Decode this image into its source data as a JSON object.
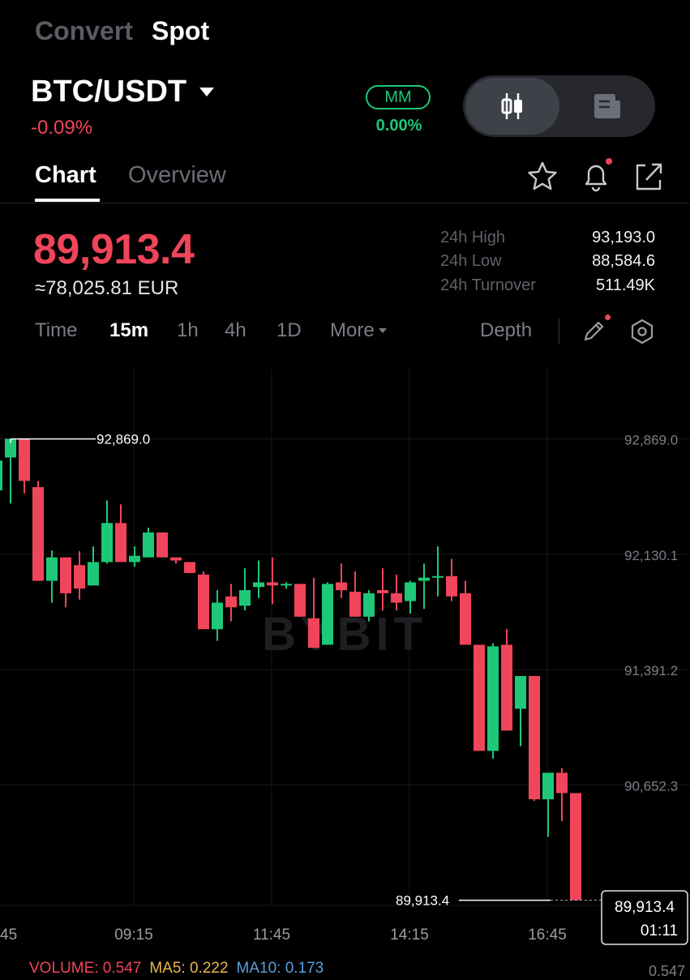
{
  "header": {
    "convert_label": "Convert",
    "spot_label": "Spot"
  },
  "pair": {
    "symbol": "BTC/USDT",
    "change": "-0.09%",
    "mm_badge": "MM",
    "mm_value": "0.00%"
  },
  "tabs": {
    "chart": "Chart",
    "overview": "Overview"
  },
  "price": {
    "last": "89,913.4",
    "eur": "≈78,025.81 EUR",
    "stats": [
      {
        "label": "24h High",
        "value": "93,193.0"
      },
      {
        "label": "24h Low",
        "value": "88,584.6"
      },
      {
        "label": "24h Turnover",
        "value": "511.49K"
      }
    ]
  },
  "timeframes": {
    "time": "Time",
    "m15": "15m",
    "h1": "1h",
    "h4": "4h",
    "d1": "1D",
    "more": "More",
    "depth": "Depth",
    "active": "15m"
  },
  "colors": {
    "up": "#1ec878",
    "down": "#f0455a",
    "background": "#000000"
  },
  "watermark": "BYBIT",
  "chart_data": {
    "type": "candlestick",
    "interval": "15m",
    "y_ticks": [
      "92,869.0",
      "92,130.1",
      "91,391.2",
      "90,652.3"
    ],
    "y_tick_values": [
      92869.0,
      92130.1,
      91391.2,
      90652.3
    ],
    "x_ticks": [
      "45",
      "09:15",
      "11:45",
      "14:15",
      "16:45"
    ],
    "high_marker": "92,869.0",
    "last_marker": "89,913.4",
    "last_price_tag": {
      "price": "89,913.4",
      "countdown": "01:11"
    },
    "ylim": [
      89880,
      93100
    ],
    "candles": [
      {
        "o": 92540,
        "h": 92870,
        "l": 92330,
        "c": 92730
      },
      {
        "o": 92750,
        "h": 92870,
        "l": 92455,
        "c": 92870
      },
      {
        "o": 92870,
        "h": 92870,
        "l": 92520,
        "c": 92600
      },
      {
        "o": 92560,
        "h": 92600,
        "l": 91960,
        "c": 91960
      },
      {
        "o": 91960,
        "h": 92155,
        "l": 91820,
        "c": 92110
      },
      {
        "o": 92110,
        "h": 92110,
        "l": 91790,
        "c": 91880
      },
      {
        "o": 92060,
        "h": 92150,
        "l": 91840,
        "c": 91910
      },
      {
        "o": 91930,
        "h": 92180,
        "l": 91930,
        "c": 92080
      },
      {
        "o": 92080,
        "h": 92475,
        "l": 92070,
        "c": 92330
      },
      {
        "o": 92330,
        "h": 92450,
        "l": 92080,
        "c": 92080
      },
      {
        "o": 92080,
        "h": 92180,
        "l": 92050,
        "c": 92120
      },
      {
        "o": 92110,
        "h": 92300,
        "l": 92110,
        "c": 92270
      },
      {
        "o": 92270,
        "h": 92270,
        "l": 92110,
        "c": 92110
      },
      {
        "o": 92110,
        "h": 92110,
        "l": 92070,
        "c": 92090
      },
      {
        "o": 92080,
        "h": 92080,
        "l": 92010,
        "c": 92010
      },
      {
        "o": 92000,
        "h": 92020,
        "l": 91650,
        "c": 91650
      },
      {
        "o": 91650,
        "h": 91900,
        "l": 91575,
        "c": 91820
      },
      {
        "o": 91860,
        "h": 91940,
        "l": 91700,
        "c": 91790
      },
      {
        "o": 91800,
        "h": 92040,
        "l": 91770,
        "c": 91900
      },
      {
        "o": 91920,
        "h": 92090,
        "l": 91850,
        "c": 91950
      },
      {
        "o": 91950,
        "h": 92110,
        "l": 91810,
        "c": 91930
      },
      {
        "o": 91935,
        "h": 91950,
        "l": 91910,
        "c": 91940
      },
      {
        "o": 91940,
        "h": 91940,
        "l": 91730,
        "c": 91730
      },
      {
        "o": 91720,
        "h": 91980,
        "l": 91530,
        "c": 91530
      },
      {
        "o": 91550,
        "h": 91950,
        "l": 91550,
        "c": 91940
      },
      {
        "o": 91950,
        "h": 92070,
        "l": 91850,
        "c": 91900
      },
      {
        "o": 91890,
        "h": 92020,
        "l": 91730,
        "c": 91730
      },
      {
        "o": 91730,
        "h": 91900,
        "l": 91700,
        "c": 91880
      },
      {
        "o": 91900,
        "h": 92040,
        "l": 91770,
        "c": 91880
      },
      {
        "o": 91880,
        "h": 92000,
        "l": 91770,
        "c": 91820
      },
      {
        "o": 91830,
        "h": 91960,
        "l": 91750,
        "c": 91950
      },
      {
        "o": 91960,
        "h": 92070,
        "l": 91780,
        "c": 91980
      },
      {
        "o": 91985,
        "h": 92180,
        "l": 91860,
        "c": 91990
      },
      {
        "o": 91990,
        "h": 92100,
        "l": 91830,
        "c": 91860
      },
      {
        "o": 91880,
        "h": 91960,
        "l": 91550,
        "c": 91550
      },
      {
        "o": 91550,
        "h": 91550,
        "l": 90870,
        "c": 90870
      },
      {
        "o": 90870,
        "h": 91560,
        "l": 90820,
        "c": 91540
      },
      {
        "o": 91550,
        "h": 91650,
        "l": 91000,
        "c": 91000
      },
      {
        "o": 91140,
        "h": 91340,
        "l": 90900,
        "c": 91350
      },
      {
        "o": 91350,
        "h": 91350,
        "l": 90550,
        "c": 90560
      },
      {
        "o": 90560,
        "h": 90700,
        "l": 90320,
        "c": 90730
      },
      {
        "o": 90730,
        "h": 90760,
        "l": 90420,
        "c": 90600
      },
      {
        "o": 90600,
        "h": 90600,
        "l": 89913.4,
        "c": 89913.4
      }
    ]
  },
  "indicators": {
    "volume": "VOLUME: 0.547",
    "ma5": "MA5: 0.222",
    "ma10": "MA10: 0.173",
    "right_value": "0.547"
  }
}
